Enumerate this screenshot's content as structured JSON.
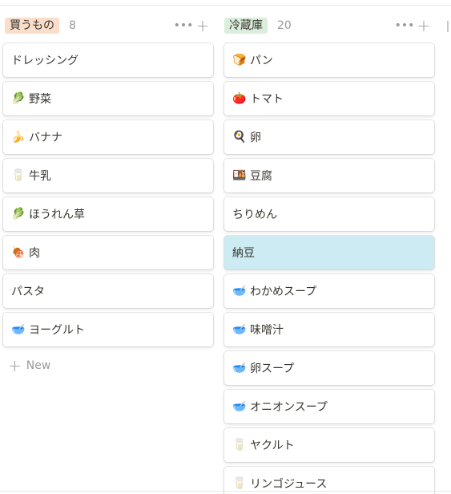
{
  "columns": [
    {
      "title": "買うもの",
      "count": "8",
      "tag_bg": "#fadec9",
      "tag_color": "#37352f",
      "cards": [
        {
          "icon": "",
          "label": "ドレッシング"
        },
        {
          "icon": "🥬",
          "label": "野菜"
        },
        {
          "icon": "🍌",
          "label": "バナナ"
        },
        {
          "icon": "🥛",
          "label": "牛乳"
        },
        {
          "icon": "🥬",
          "label": "ほうれん草"
        },
        {
          "icon": "🍖",
          "label": "肉"
        },
        {
          "icon": "",
          "label": "パスタ"
        },
        {
          "icon": "🥣",
          "label": "ヨーグルト"
        }
      ],
      "new_label": "New"
    },
    {
      "title": "冷蔵庫",
      "count": "20",
      "tag_bg": "#dbeddb",
      "tag_color": "#37352f",
      "cards": [
        {
          "icon": "🍞",
          "label": "パン"
        },
        {
          "icon": "🍅",
          "label": "トマト"
        },
        {
          "icon": "🍳",
          "label": "卵"
        },
        {
          "icon": "🍱",
          "label": "豆腐"
        },
        {
          "icon": "",
          "label": "ちりめん"
        },
        {
          "icon": "",
          "label": "納豆",
          "highlight": true
        },
        {
          "icon": "🥣",
          "label": "わかめスープ"
        },
        {
          "icon": "🥣",
          "label": "味噌汁"
        },
        {
          "icon": "🥣",
          "label": "卵スープ"
        },
        {
          "icon": "🥣",
          "label": "オニオンスープ"
        },
        {
          "icon": "🥛",
          "label": "ヤクルト"
        },
        {
          "icon": "🥛",
          "label": "リンゴジュース"
        }
      ]
    }
  ],
  "header_buttons": {
    "more": "•••",
    "add": "+"
  },
  "colors": {
    "highlight": "#cdebf3",
    "muted": "#9b9a97"
  }
}
